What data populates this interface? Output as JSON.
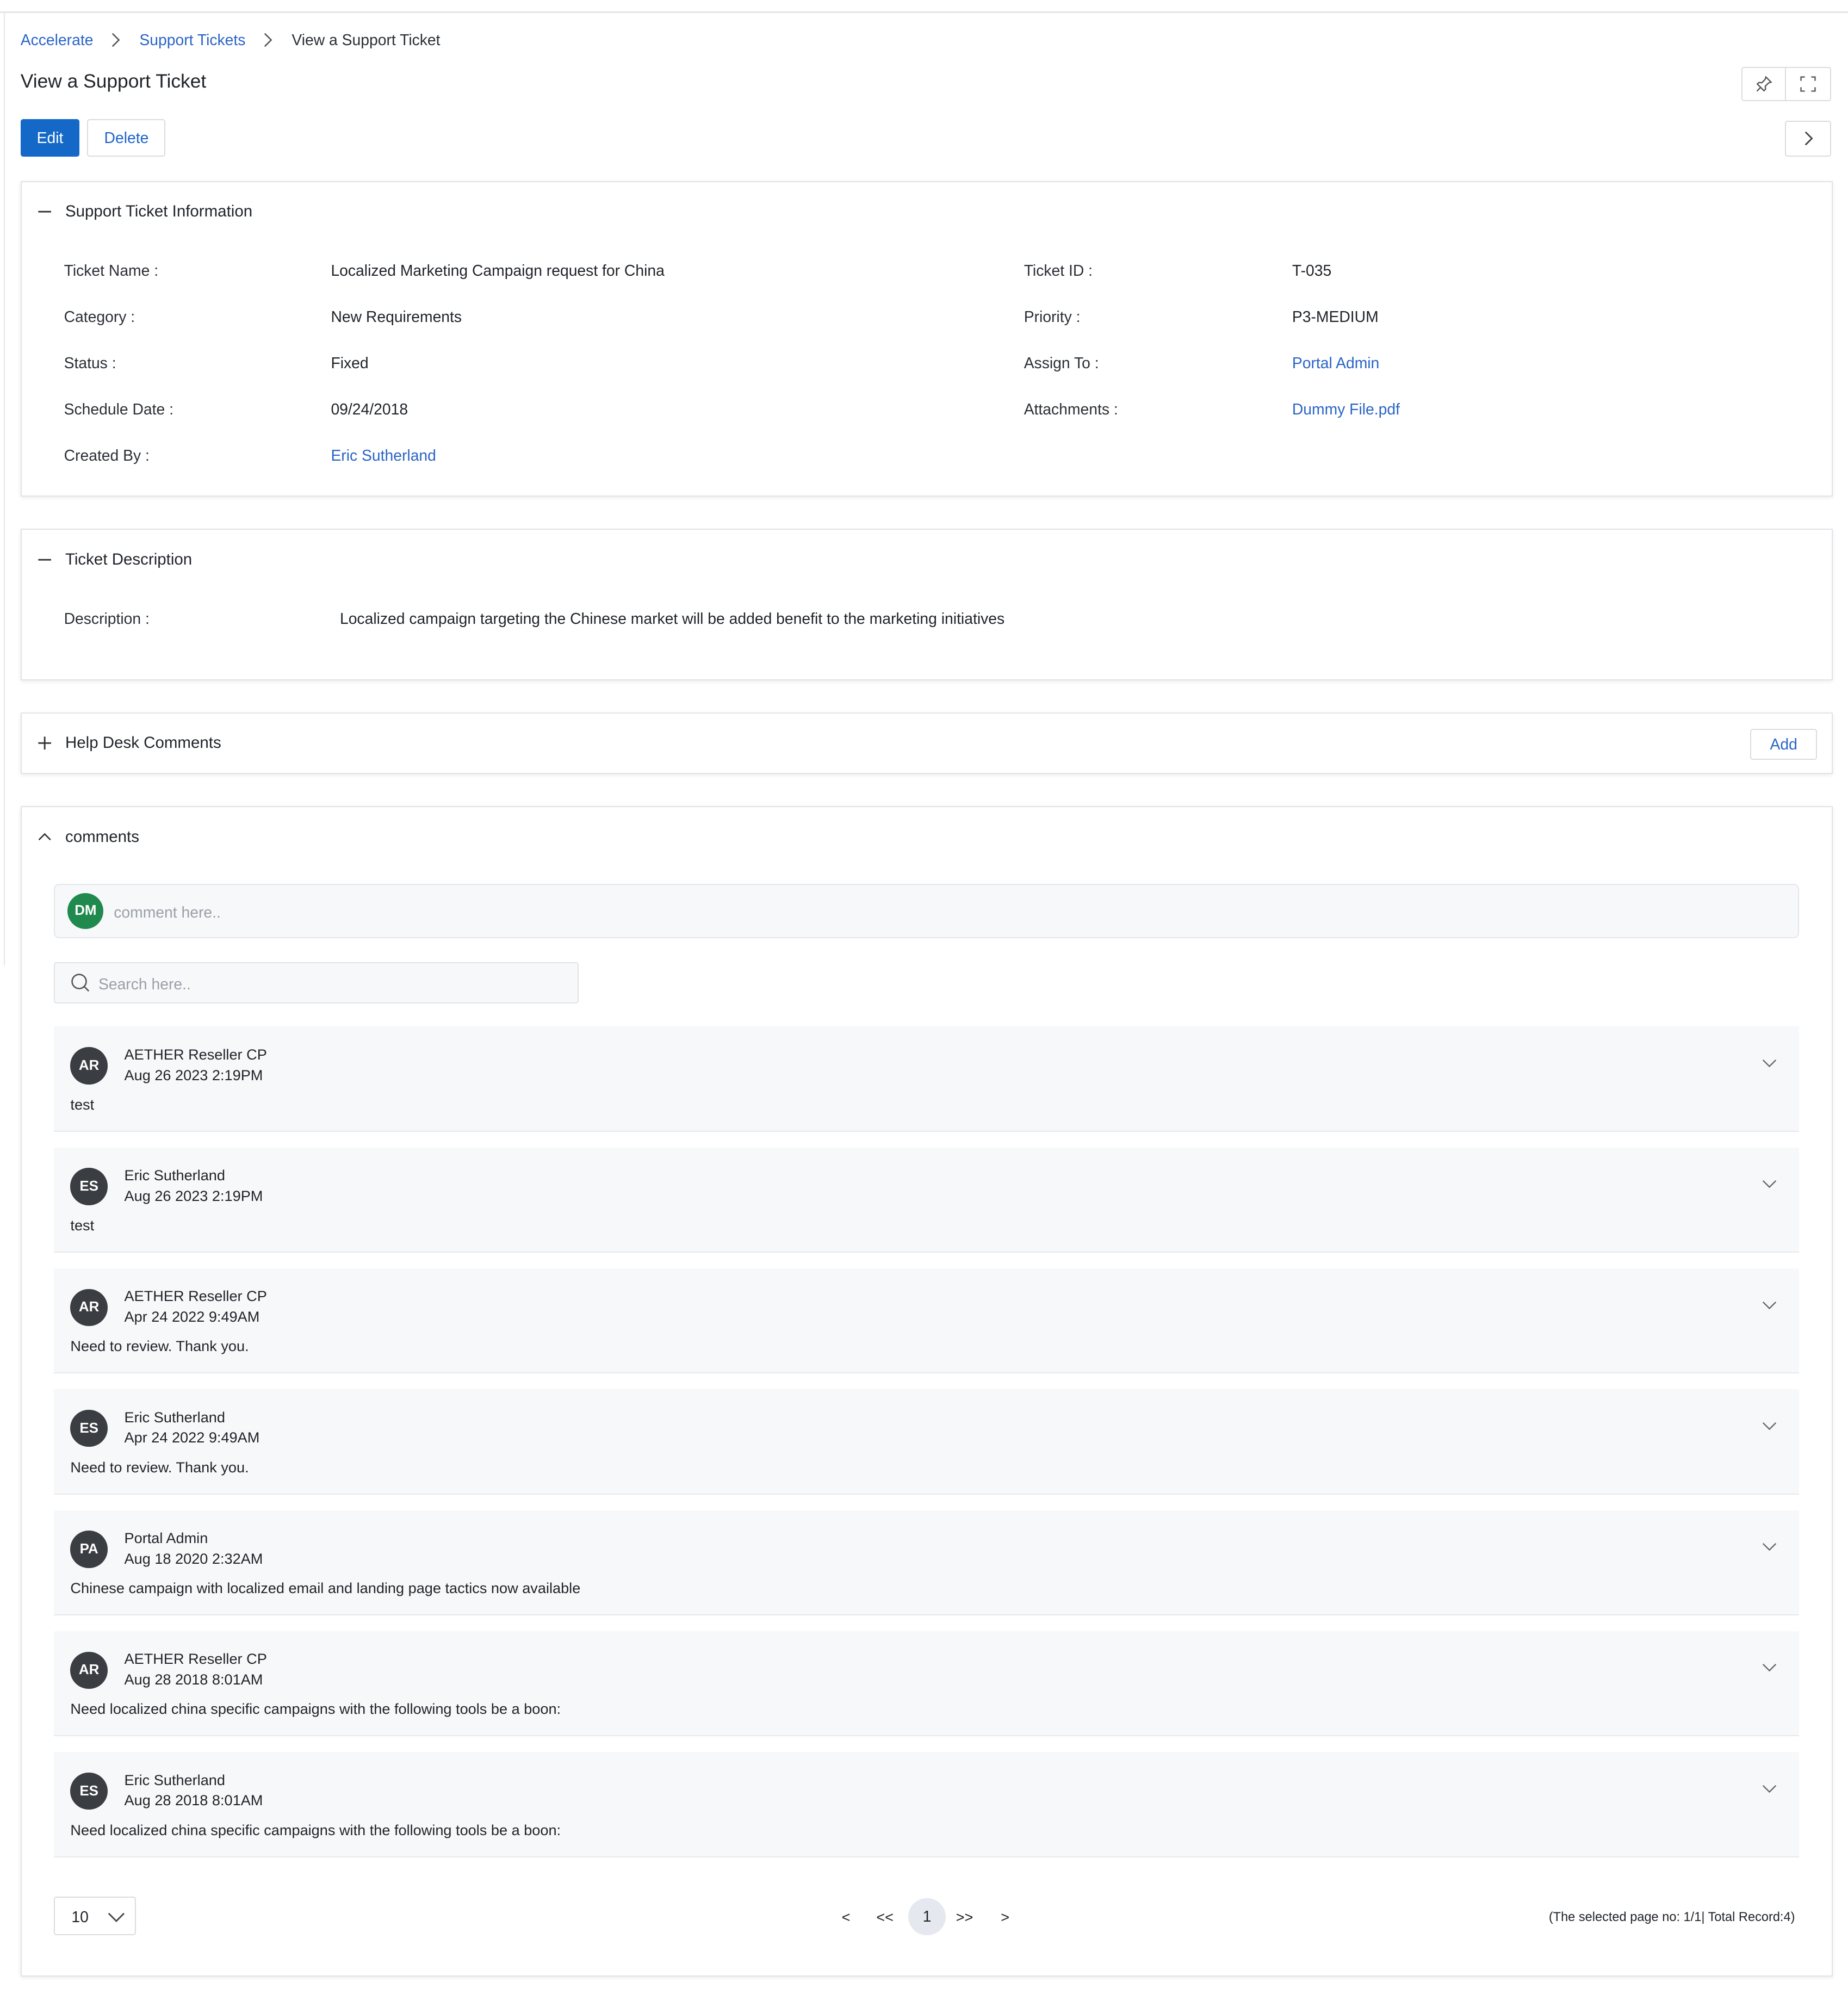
{
  "breadcrumb": {
    "items": [
      "Accelerate",
      "Support Tickets"
    ],
    "current": "View a Support Ticket"
  },
  "page": {
    "title": "View a Support Ticket"
  },
  "actions": {
    "edit": "Edit",
    "delete": "Delete"
  },
  "icons": {
    "pin": "pin-icon",
    "fullscreen": "fullscreen-icon",
    "next": "chevron-right-icon"
  },
  "ticket_info": {
    "heading": "Support Ticket Information",
    "fields": {
      "name_label": "Ticket Name :",
      "name": "Localized Marketing Campaign request for China",
      "category_label": "Category :",
      "category": "New Requirements",
      "status_label": "Status :",
      "status": "Fixed",
      "schedule_label": "Schedule Date :",
      "schedule": "09/24/2018",
      "created_label": "Created By :",
      "created": "Eric Sutherland",
      "id_label": "Ticket ID :",
      "id": "T-035",
      "priority_label": "Priority :",
      "priority": "P3-MEDIUM",
      "assign_label": "Assign To :",
      "assign": "Portal Admin",
      "attach_label": "Attachments :",
      "attach": "Dummy File.pdf"
    }
  },
  "description": {
    "heading": "Ticket Description",
    "label": "Description :",
    "text": "Localized campaign targeting the Chinese market will be added benefit to the marketing initiatives"
  },
  "helpdesk": {
    "heading": "Help Desk Comments",
    "add": "Add"
  },
  "comments": {
    "heading": "comments",
    "user_initials": "DM",
    "input_placeholder": "comment here..",
    "search_placeholder": "Search here..",
    "items": [
      {
        "initials": "AR",
        "author": "AETHER Reseller CP",
        "date": "Aug 26 2023 2:19PM",
        "text": "test"
      },
      {
        "initials": "ES",
        "author": "Eric Sutherland",
        "date": "Aug 26 2023 2:19PM",
        "text": "test"
      },
      {
        "initials": "AR",
        "author": "AETHER Reseller CP",
        "date": "Apr 24 2022 9:49AM",
        "text": "Need to review. Thank you."
      },
      {
        "initials": "ES",
        "author": "Eric Sutherland",
        "date": "Apr 24 2022 9:49AM",
        "text": "Need to review. Thank you."
      },
      {
        "initials": "PA",
        "author": "Portal Admin",
        "date": "Aug 18 2020 2:32AM",
        "text": "Chinese campaign with localized email and landing page tactics now available"
      },
      {
        "initials": "AR",
        "author": "AETHER Reseller CP",
        "date": "Aug 28 2018 8:01AM",
        "text": "Need localized china specific campaigns with the following tools be a boon:"
      },
      {
        "initials": "ES",
        "author": "Eric Sutherland",
        "date": "Aug 28 2018 8:01AM",
        "text": "Need localized china specific campaigns with the following tools be a boon:"
      }
    ]
  },
  "pagination": {
    "page_size": "10",
    "prev": "<",
    "first": "<<",
    "current": "1",
    "last": ">>",
    "next": ">",
    "info": "(The selected page no: 1/1| Total Record:4)"
  },
  "colors": {
    "primary": "#1469c8",
    "link": "#2a64c7",
    "avatar_dm": "#208a4e",
    "avatar": "#3a3d42"
  }
}
